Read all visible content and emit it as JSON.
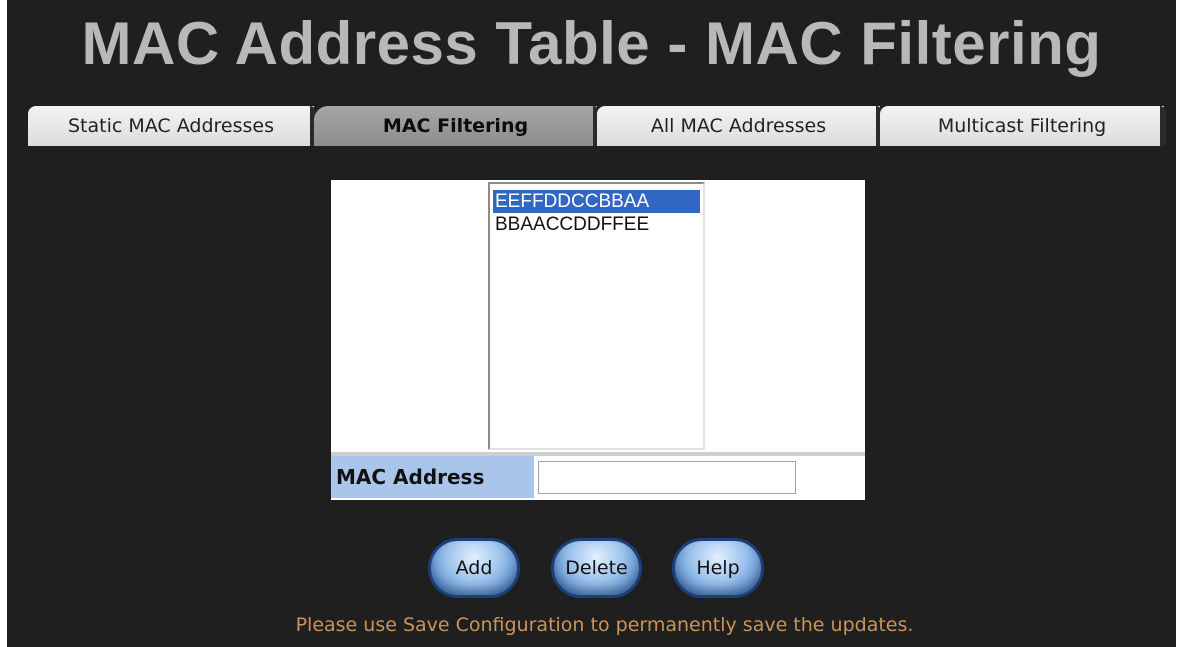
{
  "title": "MAC Address Table - MAC Filtering",
  "tabs": [
    {
      "label": "Static MAC Addresses",
      "active": false
    },
    {
      "label": "MAC Filtering",
      "active": true
    },
    {
      "label": "All MAC Addresses",
      "active": false
    },
    {
      "label": "Multicast Filtering",
      "active": false
    }
  ],
  "mac_list": {
    "options": [
      "EEFFDDCCBBAA",
      "BBAACCDDFFEE"
    ],
    "selected": "EEFFDDCCBBAA"
  },
  "mac_field": {
    "label": "MAC Address",
    "value": ""
  },
  "buttons": {
    "add": "Add",
    "delete": "Delete",
    "help": "Help"
  },
  "note": "Please use Save Configuration to permanently save the updates.",
  "colors": {
    "background": "#1f1f1f",
    "title": "#b8b8b8",
    "selection": "#3166c4",
    "label_bg": "#a9c5ea",
    "note": "#c9945a",
    "button": "#2f69b7"
  }
}
